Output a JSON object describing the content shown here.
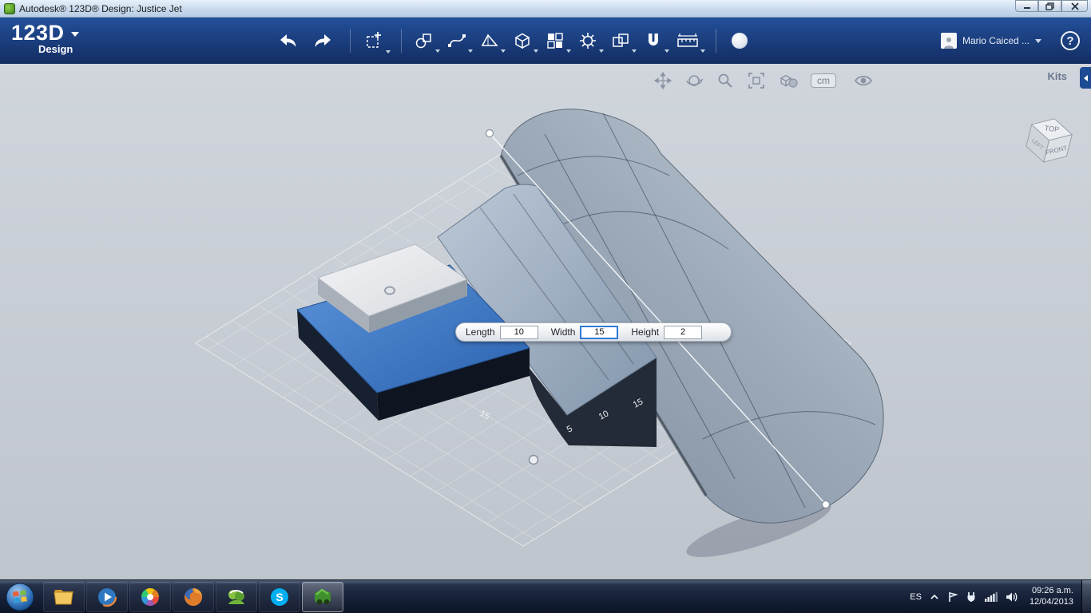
{
  "window": {
    "title": "Autodesk® 123D® Design: Justice Jet"
  },
  "header": {
    "logo": "123D",
    "logo_sub": "Design",
    "user_name": "Mario Caiced ...",
    "help_label": "?",
    "tools": [
      "undo",
      "redo",
      "transform",
      "primitives",
      "sketch",
      "construct",
      "box",
      "pattern",
      "modify",
      "combine",
      "snap",
      "measure",
      "material"
    ]
  },
  "viewport": {
    "kits_label": "Kits",
    "nav": {
      "units_label": "cm",
      "icons": [
        "pan",
        "orbit",
        "zoom",
        "fit-view",
        "shading",
        "units",
        "visibility"
      ]
    },
    "viewcube": {
      "top": "TOP",
      "front": "FRONT",
      "left": "LEFT"
    },
    "dimension_box": {
      "length_label": "Length",
      "length_value": "10",
      "width_label": "Width",
      "width_value": "15",
      "height_label": "Height",
      "height_value": "2"
    },
    "grid_labels": [
      "5",
      "10",
      "15",
      "15"
    ]
  },
  "taskbar": {
    "apps": [
      "start",
      "explorer",
      "media-player",
      "color-wheel",
      "firefox",
      "messenger",
      "skype",
      "123d-design"
    ],
    "skype_letter": "S",
    "tray": {
      "language": "ES",
      "time": "09:26 a.m.",
      "date": "12/04/2013"
    }
  }
}
